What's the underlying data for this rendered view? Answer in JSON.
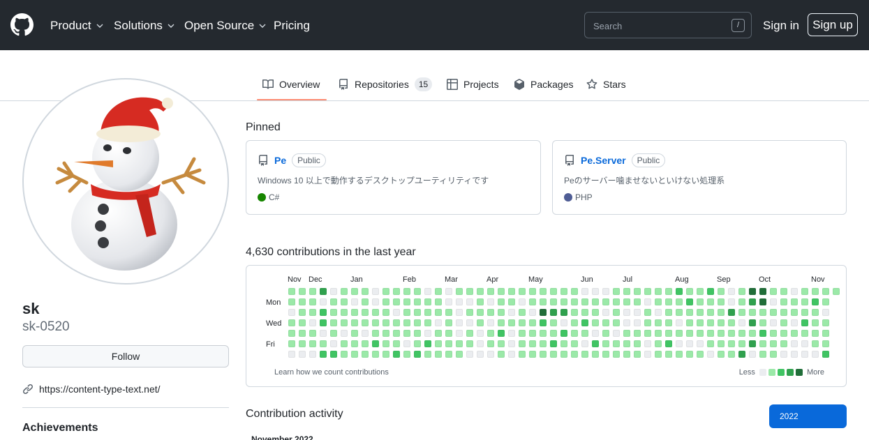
{
  "header": {
    "nav": [
      {
        "label": "Product",
        "dropdown": true
      },
      {
        "label": "Solutions",
        "dropdown": true
      },
      {
        "label": "Open Source",
        "dropdown": true
      },
      {
        "label": "Pricing",
        "dropdown": false
      }
    ],
    "search_placeholder": "Search",
    "search_shortcut": "/",
    "sign_in": "Sign in",
    "sign_up": "Sign up"
  },
  "tabs": [
    {
      "label": "Overview",
      "icon": "book-icon",
      "active": true
    },
    {
      "label": "Repositories",
      "icon": "repo-icon",
      "count": "15"
    },
    {
      "label": "Projects",
      "icon": "table-icon"
    },
    {
      "label": "Packages",
      "icon": "package-icon"
    },
    {
      "label": "Stars",
      "icon": "star-icon"
    }
  ],
  "profile": {
    "avatar": "snowman-with-santa-hat",
    "name": "sk",
    "login": "sk-0520",
    "follow_label": "Follow",
    "website": "https://content-type-text.net/",
    "achievements_heading": "Achievements"
  },
  "pinned": {
    "heading": "Pinned",
    "items": [
      {
        "name": "Pe",
        "visibility": "Public",
        "description": "Windows 10 以上で動作するデスクトップユーティリティです",
        "language": "C#",
        "language_color": "#178600"
      },
      {
        "name": "Pe.Server",
        "visibility": "Public",
        "description": "Peのサーバー噛ませないといけない処理系",
        "language": "PHP",
        "language_color": "#4F5D95"
      }
    ]
  },
  "contributions": {
    "heading": "4,630 contributions in the last year",
    "months": [
      "Nov",
      "Dec",
      "Jan",
      "Feb",
      "Mar",
      "Apr",
      "May",
      "Jun",
      "Jul",
      "Aug",
      "Sep",
      "Oct",
      "Nov"
    ],
    "day_labels": [
      "Mon",
      "Wed",
      "Fri"
    ],
    "learn_link": "Learn how we count contributions",
    "legend_less": "Less",
    "legend_more": "More",
    "level_colors": [
      "#ebedf0",
      "#9be9a8",
      "#40c463",
      "#30a14e",
      "#216e39"
    ]
  },
  "activity": {
    "heading": "Contribution activity",
    "year_selected": "2022",
    "partial_label": "November 2022"
  }
}
